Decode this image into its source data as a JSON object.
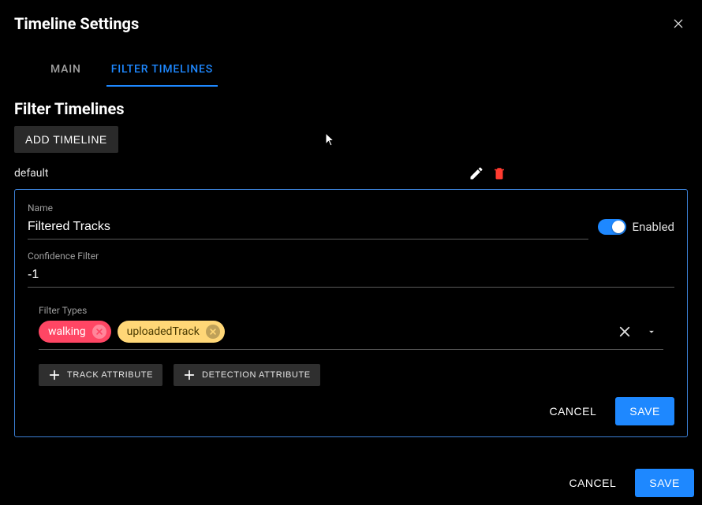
{
  "header": {
    "title": "Timeline Settings"
  },
  "tabs": {
    "main": "MAIN",
    "filter": "FILTER TIMELINES",
    "active": "filter"
  },
  "section": {
    "title": "Filter Timelines"
  },
  "add_timeline_label": "ADD TIMELINE",
  "timeline_list": {
    "items": [
      {
        "name": "default"
      }
    ]
  },
  "editor": {
    "name_label": "Name",
    "name_value": "Filtered Tracks",
    "enabled_label": "Enabled",
    "enabled_value": true,
    "confidence_label": "Confidence Filter",
    "confidence_value": "-1",
    "filter_types_label": "Filter Types",
    "chips": [
      {
        "label": "walking",
        "color": "pink"
      },
      {
        "label": "uploadedTrack",
        "color": "amber"
      }
    ],
    "track_attr_label": "TRACK ATTRIBUTE",
    "detection_attr_label": "DETECTION ATTRIBUTE",
    "cancel_label": "CANCEL",
    "save_label": "SAVE"
  },
  "footer": {
    "cancel_label": "CANCEL",
    "save_label": "SAVE"
  }
}
